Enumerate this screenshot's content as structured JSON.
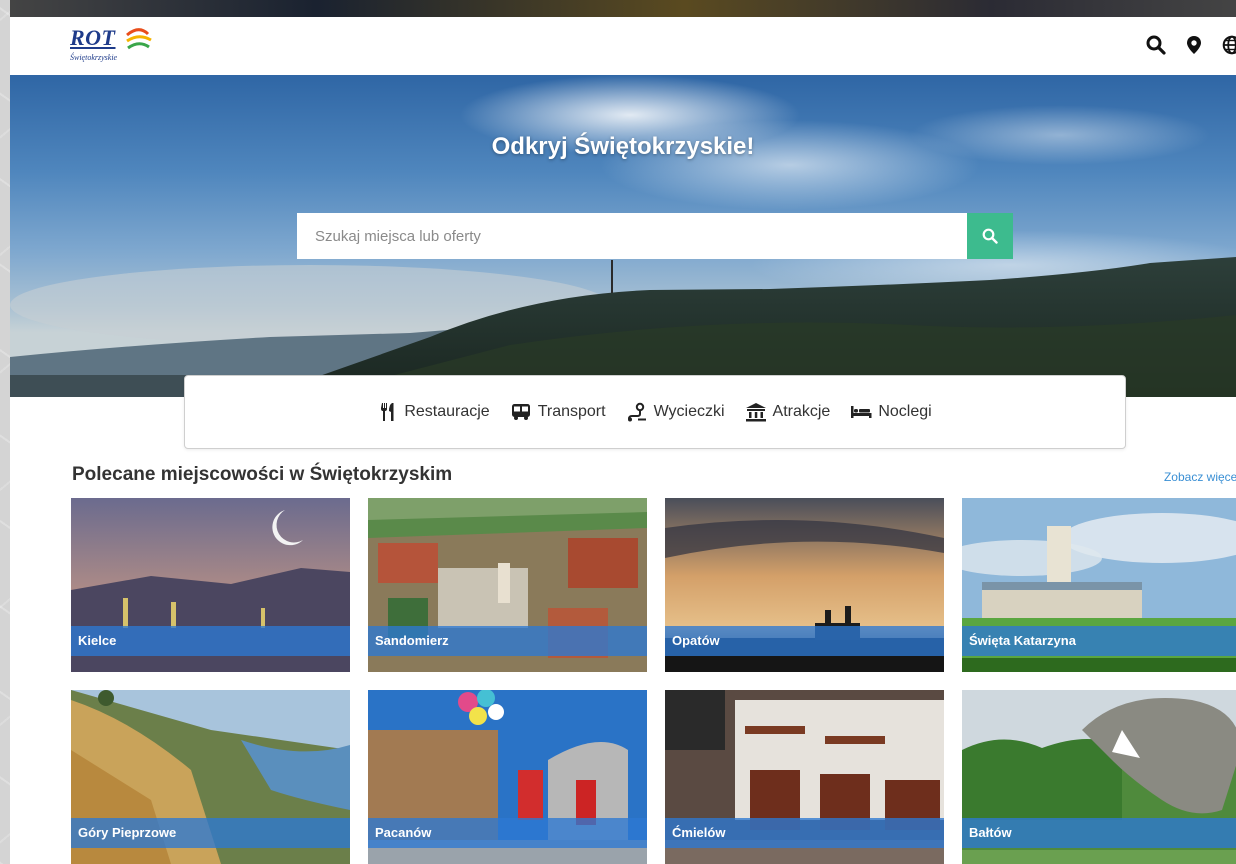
{
  "header": {
    "logo_text": "ROT",
    "logo_subtitle": "Świętokrzyskie",
    "icons": [
      "search-icon",
      "map-pin-icon",
      "globe-icon"
    ]
  },
  "hero": {
    "title": "Odkryj Świętokrzyskie!",
    "search_placeholder": "Szukaj miejsca lub oferty"
  },
  "categories": [
    {
      "label": "Restauracje",
      "icon": "restaurant-icon"
    },
    {
      "label": "Transport",
      "icon": "bus-icon"
    },
    {
      "label": "Wycieczki",
      "icon": "route-icon"
    },
    {
      "label": "Atrakcje",
      "icon": "museum-icon"
    },
    {
      "label": "Noclegi",
      "icon": "bed-icon"
    }
  ],
  "featured": {
    "title": "Polecane miejscowości w Świętokrzyskim",
    "see_more": "Zobacz więcej",
    "places": [
      {
        "name": "Kielce"
      },
      {
        "name": "Sandomierz"
      },
      {
        "name": "Opatów"
      },
      {
        "name": "Święta Katarzyna"
      },
      {
        "name": "Góry Pieprzowe"
      },
      {
        "name": "Pacanów"
      },
      {
        "name": "Ćmielów"
      },
      {
        "name": "Bałtów"
      }
    ]
  },
  "colors": {
    "accent_green": "#3dbb8e",
    "label_blue": "#2d78d2",
    "link_blue": "#3a8fd4"
  }
}
